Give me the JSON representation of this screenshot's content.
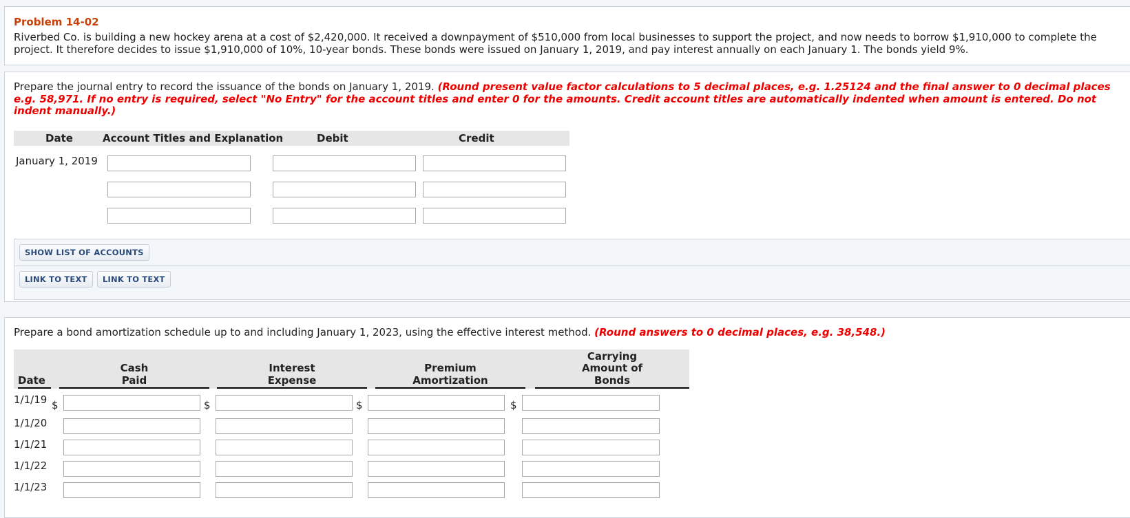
{
  "problem": {
    "title": "Problem 14-02",
    "text": "Riverbed Co. is building a new hockey arena at a cost of $2,420,000. It received a downpayment of $510,000 from local businesses to support the project, and now needs to borrow $1,910,000 to complete the project. It therefore decides to issue $1,910,000 of 10%, 10-year bonds. These bonds were issued on January 1, 2019, and pay interest annually on each January 1. The bonds yield 9%."
  },
  "journal": {
    "instruction": "Prepare the journal entry to record the issuance of the bonds on January 1, 2019.",
    "instruction_note": "(Round present value factor calculations to 5 decimal places, e.g. 1.25124 and the final answer to 0 decimal places e.g. 58,971. If no entry is required, select \"No Entry\" for the account titles and enter 0 for the amounts. Credit account titles are automatically indented when amount is entered. Do not indent manually.)",
    "headers": {
      "date": "Date",
      "account": "Account Titles and Explanation",
      "debit": "Debit",
      "credit": "Credit"
    },
    "date": "January 1, 2019",
    "rows": [
      {
        "account": "",
        "debit": "",
        "credit": ""
      },
      {
        "account": "",
        "debit": "",
        "credit": ""
      },
      {
        "account": "",
        "debit": "",
        "credit": ""
      }
    ],
    "buttons": {
      "show_accounts": "SHOW LIST OF ACCOUNTS",
      "link1": "LINK TO TEXT",
      "link2": "LINK TO TEXT"
    }
  },
  "schedule": {
    "instruction": "Prepare a bond amortization schedule up to and including January 1, 2023, using the effective interest method.",
    "instruction_note": "(Round answers to 0 decimal places, e.g. 38,548.)",
    "headers": {
      "date": "Date",
      "cash_paid_1": "Cash",
      "cash_paid_2": "Paid",
      "interest_1": "Interest",
      "interest_2": "Expense",
      "premium_1": "Premium",
      "premium_2": "Amortization",
      "carrying_1": "Carrying",
      "carrying_2": "Amount of",
      "carrying_3": "Bonds"
    },
    "currency_symbol": "$",
    "rows": [
      {
        "date": "1/1/19",
        "cash_paid": "",
        "interest_expense": "",
        "premium_amortization": "",
        "carrying_amount": ""
      },
      {
        "date": "1/1/20",
        "cash_paid": "",
        "interest_expense": "",
        "premium_amortization": "",
        "carrying_amount": ""
      },
      {
        "date": "1/1/21",
        "cash_paid": "",
        "interest_expense": "",
        "premium_amortization": "",
        "carrying_amount": ""
      },
      {
        "date": "1/1/22",
        "cash_paid": "",
        "interest_expense": "",
        "premium_amortization": "",
        "carrying_amount": ""
      },
      {
        "date": "1/1/23",
        "cash_paid": "",
        "interest_expense": "",
        "premium_amortization": "",
        "carrying_amount": ""
      }
    ]
  }
}
